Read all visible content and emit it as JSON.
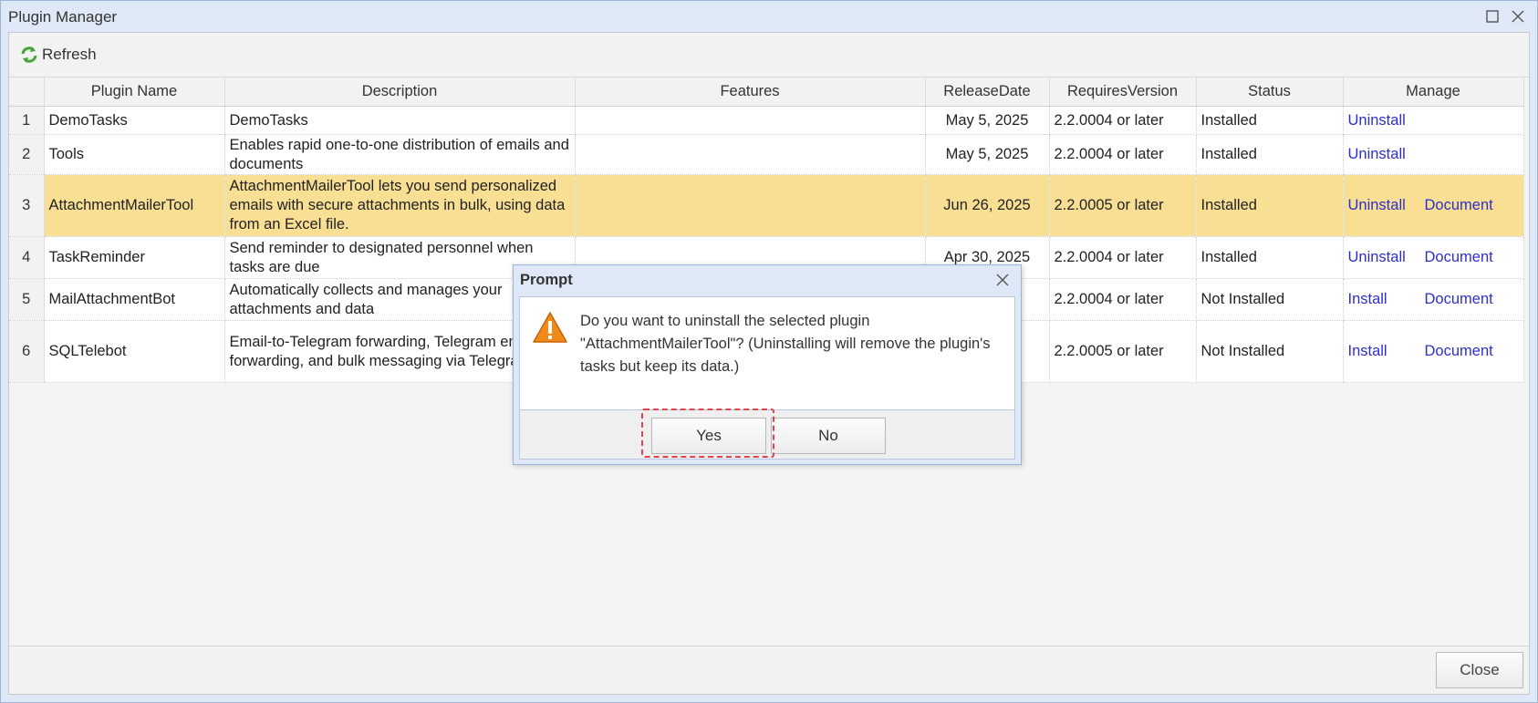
{
  "window": {
    "title": "Plugin Manager"
  },
  "toolbar": {
    "refresh_label": "Refresh"
  },
  "table": {
    "columns": [
      "Plugin Name",
      "Description",
      "Features",
      "ReleaseDate",
      "RequiresVersion",
      "Status",
      "Manage"
    ],
    "rows": [
      {
        "num": "1",
        "name": "DemoTasks",
        "description": "DemoTasks",
        "features": "",
        "release": "May 5, 2025",
        "requires": "2.2.0004 or later",
        "status": "Installed",
        "action": "Uninstall",
        "document": ""
      },
      {
        "num": "2",
        "name": "Tools",
        "description": "Enables rapid one-to-one distribution of emails and documents",
        "features": "",
        "release": "May 5, 2025",
        "requires": "2.2.0004 or later",
        "status": "Installed",
        "action": "Uninstall",
        "document": ""
      },
      {
        "num": "3",
        "name": "AttachmentMailerTool",
        "description": "AttachmentMailerTool lets you send personalized emails with secure attachments in bulk, using data from an Excel file.",
        "features": "",
        "release": "Jun 26, 2025",
        "requires": "2.2.0005 or later",
        "status": "Installed",
        "action": "Uninstall",
        "document": "Document"
      },
      {
        "num": "4",
        "name": "TaskReminder",
        "description": "Send reminder to designated personnel when tasks are due",
        "features": "",
        "release": "Apr 30, 2025",
        "requires": "2.2.0004 or later",
        "status": "Installed",
        "action": "Uninstall",
        "document": "Document"
      },
      {
        "num": "5",
        "name": "MailAttachmentBot",
        "description": "Automatically collects and manages your attachments and data",
        "features": "",
        "release": "",
        "requires": "2.2.0004 or later",
        "status": "Not Installed",
        "action": "Install",
        "document": "Document"
      },
      {
        "num": "6",
        "name": "SQLTelebot",
        "description": "Email-to-Telegram forwarding, Telegram email forwarding, and bulk messaging via Telegram",
        "features": "",
        "release": "",
        "requires": "2.2.0005 or later",
        "status": "Not Installed",
        "action": "Install",
        "document": "Document"
      }
    ]
  },
  "footer": {
    "close_label": "Close"
  },
  "dialog": {
    "title": "Prompt",
    "message": "Do you want to uninstall the selected plugin \"AttachmentMailerTool\"? (Uninstalling will remove the plugin's tasks but keep its data.)",
    "yes_label": "Yes",
    "no_label": "No"
  },
  "colors": {
    "selected_row": "#f8df93",
    "link": "#2f2fc8",
    "focus_ring": "#e0454c",
    "warning": "#f08a1c"
  }
}
